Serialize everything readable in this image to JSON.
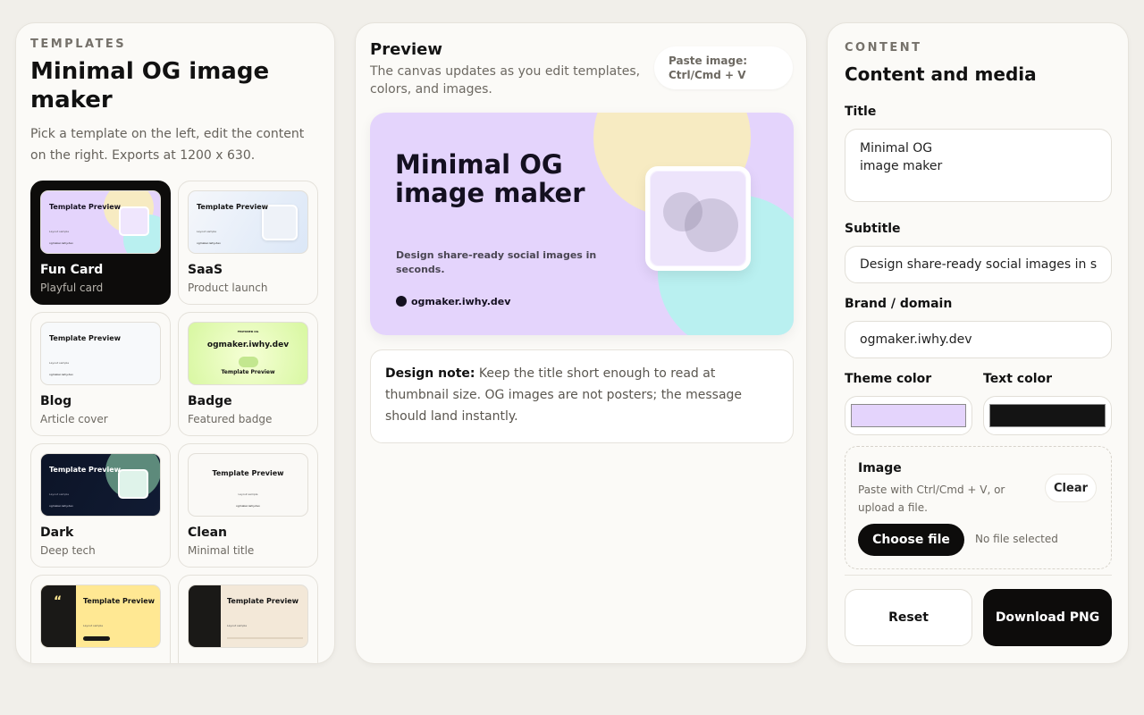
{
  "templates_panel": {
    "eyebrow": "TEMPLATES",
    "title": "Minimal OG image maker",
    "description": "Pick a template on the left, edit the content on the right. Exports at 1200 x 630.",
    "thumb_title": "Template Preview",
    "thumb_sub": "Layout sample",
    "thumb_brand": "ogmaker.iwhy.dev",
    "badge_domain": "ogmaker.iwhy.dev",
    "badge_tag": "FEATURED OG",
    "templates": [
      {
        "name": "Fun Card",
        "desc": "Playful card",
        "active": true
      },
      {
        "name": "SaaS",
        "desc": "Product launch",
        "active": false
      },
      {
        "name": "Blog",
        "desc": "Article cover",
        "active": false
      },
      {
        "name": "Badge",
        "desc": "Featured badge",
        "active": false
      },
      {
        "name": "Dark",
        "desc": "Deep tech",
        "active": false
      },
      {
        "name": "Clean",
        "desc": "Minimal title",
        "active": false
      },
      {
        "name": "",
        "desc": "",
        "active": false
      },
      {
        "name": "",
        "desc": "",
        "active": false
      }
    ]
  },
  "preview_panel": {
    "title": "Preview",
    "subtitle": "The canvas updates as you edit templates, colors, and images.",
    "paste_hint": "Paste image: Ctrl/Cmd + V",
    "og": {
      "title": "Minimal OG image maker",
      "subtitle": "Design share-ready social images in seconds.",
      "brand": "ogmaker.iwhy.dev"
    },
    "note_label": "Design note:",
    "note_text": " Keep the title short enough to read at thumbnail size. OG images are not posters; the message should land instantly."
  },
  "content_panel": {
    "eyebrow": "CONTENT",
    "title": "Content and media",
    "title_label": "Title",
    "title_value": "Minimal OG\nimage maker",
    "subtitle_label": "Subtitle",
    "subtitle_value": "Design share-ready social images in seconds.",
    "brand_label": "Brand / domain",
    "brand_value": "ogmaker.iwhy.dev",
    "theme_label": "Theme color",
    "theme_color": "#e4d4fc",
    "text_label": "Text color",
    "text_color": "#141414",
    "image_label": "Image",
    "image_desc": "Paste with Ctrl/Cmd + V, or upload a file.",
    "clear_label": "Clear",
    "choose_label": "Choose file",
    "no_file": "No file selected",
    "reset_label": "Reset",
    "download_label": "Download PNG"
  }
}
